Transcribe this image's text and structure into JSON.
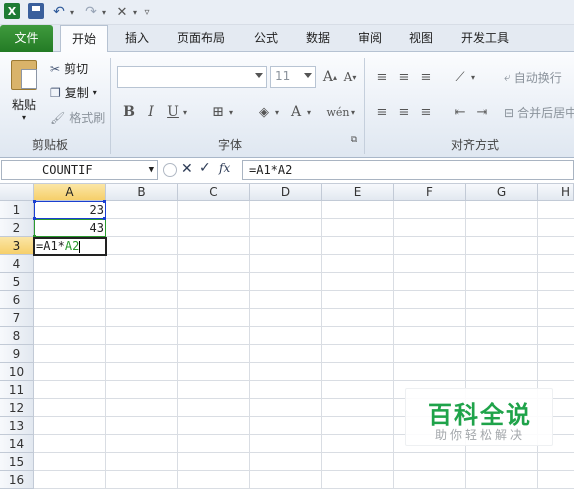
{
  "quick_access": {
    "icons": [
      "excel-logo-icon",
      "save-icon",
      "undo-icon",
      "redo-icon",
      "customize-icon"
    ],
    "excel_letter": "X"
  },
  "tabs": [
    "文件",
    "开始",
    "插入",
    "页面布局",
    "公式",
    "数据",
    "审阅",
    "视图",
    "开发工具"
  ],
  "active_tab": "开始",
  "ribbon": {
    "clipboard": {
      "paste": "粘贴",
      "cut": "剪切",
      "copy": "复制",
      "format_painter": "格式刷",
      "label": "剪贴板"
    },
    "font": {
      "label": "字体",
      "font_name": "",
      "font_size": "11",
      "bold": "B",
      "italic": "I",
      "underline": "U",
      "grow": "A",
      "shrink": "A"
    },
    "alignment": {
      "label": "对齐方式",
      "wrap_text": "自动换行",
      "merge_center": "合并后居中"
    }
  },
  "formula_bar": {
    "name_box": "COUNTIF",
    "fx": "fx",
    "formula": "=A1*A2"
  },
  "columns": [
    "A",
    "B",
    "C",
    "D",
    "E",
    "F",
    "G",
    "H"
  ],
  "rows": [
    "1",
    "2",
    "3",
    "4",
    "5",
    "6",
    "7",
    "8",
    "9",
    "10",
    "11",
    "12",
    "13",
    "14",
    "15",
    "16"
  ],
  "cells": {
    "A1": "23",
    "A2": "43",
    "A3_part1": "=A1*",
    "A3_part2": "A2"
  },
  "colors": {
    "file_tab": "#2e8b32",
    "ref_blue": "#1a3fd1",
    "ref_green": "#2a9a2f"
  },
  "watermark": {
    "logo": "百科全说",
    "subtitle": "助你轻松解决"
  }
}
